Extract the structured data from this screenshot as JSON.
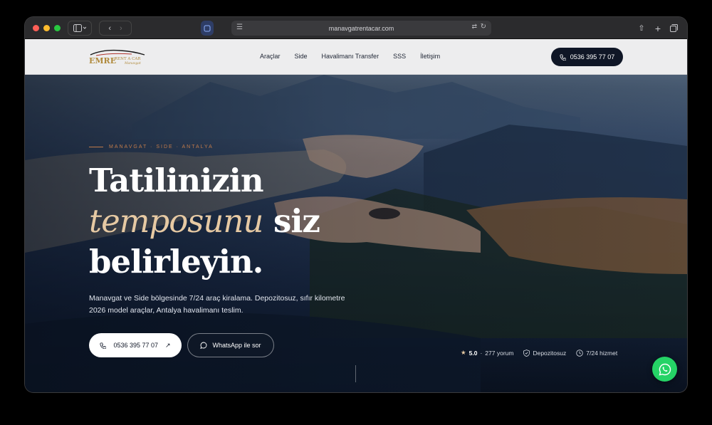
{
  "browser": {
    "url": "manavgatrentacar.com",
    "colors": {
      "close": "#ff5f57",
      "minimize": "#febc2e",
      "zoom": "#28c840"
    }
  },
  "navbar": {
    "logo": {
      "name": "EMRE",
      "tag": "RENT A CAR",
      "script": "Manavgat"
    },
    "links": [
      "Araçlar",
      "Side",
      "Havalimanı Transfer",
      "SSS",
      "İletişim"
    ],
    "phone": "0536 395 77 07"
  },
  "hero": {
    "eyebrow": "MANAVGAT · SIDE · ANTALYA",
    "headline_1": "Tatilinizin",
    "headline_2_accent": "temposunu",
    "headline_2_rest": " siz",
    "headline_3": "belirleyin.",
    "subtext": "Manavgat ve Side bölgesinde 7/24 araç kiralama. Depozitosuz, sıfır kilometre 2026 model araçlar, Antalya havalimanı teslim.",
    "phone_button": "0536 395 77 07",
    "whatsapp_button": "WhatsApp ile sor",
    "stats": {
      "rating": "5.0",
      "reviews": "277 yorum",
      "deposit": "Depozitosuz",
      "service": "7/24 hizmet"
    }
  },
  "colors": {
    "accent": "#e6c9a3",
    "dark": "#0f1626",
    "whatsapp": "#25d366",
    "eyebrow": "#c07a4a"
  }
}
